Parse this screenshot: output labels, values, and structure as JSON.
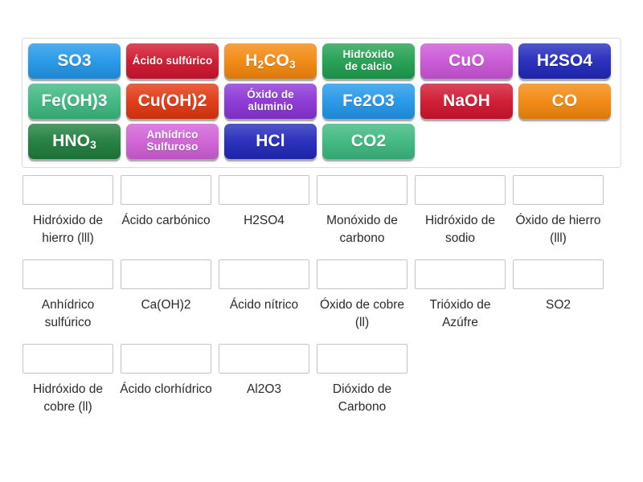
{
  "tray": {
    "name": "draggable-tiles-tray",
    "tiles": [
      {
        "id": "tile-so3",
        "label": "SO3",
        "html": "SO3",
        "color": "#2196e8",
        "size": "fs-big"
      },
      {
        "id": "tile-acido-sulfurico",
        "label": "Ácido sulfúrico",
        "html": "Ácido sulfúrico",
        "color": "#cf152d",
        "size": "fs-small"
      },
      {
        "id": "tile-h2co3",
        "label": "H2CO3",
        "html": "H<sub>2</sub>CO<sub>3</sub>",
        "color": "#f2870d",
        "size": "fs-big"
      },
      {
        "id": "tile-hidroxido-calcio",
        "label": "Hidróxido de calcio",
        "html": "Hidróxido<br>de calcio",
        "color": "#1f9e4f",
        "size": "fs-small"
      },
      {
        "id": "tile-cuo",
        "label": "CuO",
        "html": "CuO",
        "color": "#c955d6",
        "size": "fs-big"
      },
      {
        "id": "tile-h2so4",
        "label": "H2SO4",
        "html": "H2SO4",
        "color": "#2128ba",
        "size": "fs-big"
      },
      {
        "id": "tile-feoh3",
        "label": "Fe(OH)3",
        "html": "Fe(OH)3",
        "color": "#3bb77e",
        "size": "fs-big"
      },
      {
        "id": "tile-cuoh2",
        "label": "Cu(OH)2",
        "html": "Cu(OH)2",
        "color": "#e0360f",
        "size": "fs-big"
      },
      {
        "id": "tile-oxido-aluminio",
        "label": "Óxido de aluminio",
        "html": "Óxido de<br>aluminio",
        "color": "#8a33d6",
        "size": "fs-small"
      },
      {
        "id": "tile-fe2o3",
        "label": "Fe2O3",
        "html": "Fe2O3",
        "color": "#2196e8",
        "size": "fs-big"
      },
      {
        "id": "tile-naoh",
        "label": "NaOH",
        "html": "NaOH",
        "color": "#cf152d",
        "size": "fs-big"
      },
      {
        "id": "tile-co",
        "label": "CO",
        "html": "CO",
        "color": "#f2870d",
        "size": "fs-big"
      },
      {
        "id": "tile-hno3",
        "label": "HNO3",
        "html": "HNO<sub>3</sub>",
        "color": "#1e7c3c",
        "size": "fs-big"
      },
      {
        "id": "tile-anhidrico-sulfuroso",
        "label": "Anhídrico Sulfuroso",
        "html": "Anhídrico<br>Sulfuroso",
        "color": "#cf5fd6",
        "size": "fs-small"
      },
      {
        "id": "tile-hcl",
        "label": "HCl",
        "html": "HCl",
        "color": "#2128ba",
        "size": "fs-big"
      },
      {
        "id": "tile-co2",
        "label": "CO2",
        "html": "CO2",
        "color": "#3bb77e",
        "size": "fs-big"
      }
    ]
  },
  "answers": {
    "name": "answer-dropzones",
    "rows": [
      [
        {
          "id": "zone-hidroxido-hierro-iii",
          "label": "Hidróxido de hierro (lll)",
          "value": ""
        },
        {
          "id": "zone-acido-carbonico",
          "label": "Ácido carbónico",
          "value": ""
        },
        {
          "id": "zone-h2so4",
          "label": "H2SO4",
          "value": ""
        },
        {
          "id": "zone-monoxido-carbono",
          "label": "Monóxido de carbono",
          "value": ""
        },
        {
          "id": "zone-hidroxido-sodio",
          "label": "Hidróxido de sodio",
          "value": ""
        },
        {
          "id": "zone-oxido-hierro-iii",
          "label": "Óxido de hierro (lll)",
          "value": ""
        }
      ],
      [
        {
          "id": "zone-anhidrico-sulfurico",
          "label": "Anhídrico sulfúrico",
          "value": ""
        },
        {
          "id": "zone-caoh2",
          "label": "Ca(OH)2",
          "value": ""
        },
        {
          "id": "zone-acido-nitrico",
          "label": "Ácido nítrico",
          "value": ""
        },
        {
          "id": "zone-oxido-cobre-ii",
          "label": "Óxido de cobre (ll)",
          "value": ""
        },
        {
          "id": "zone-trioxido-azufre",
          "label": "Trióxido de Azúfre",
          "value": ""
        },
        {
          "id": "zone-so2",
          "label": "SO2",
          "value": ""
        }
      ],
      [
        {
          "id": "zone-hidroxido-cobre-ii",
          "label": "Hidróxido de cobre (ll)",
          "value": ""
        },
        {
          "id": "zone-acido-clorhidrico",
          "label": "Ácido clorhídrico",
          "value": ""
        },
        {
          "id": "zone-al2o3",
          "label": "Al2O3",
          "value": ""
        },
        {
          "id": "zone-dioxido-carbono",
          "label": "Dióxido de Carbono",
          "value": ""
        }
      ]
    ]
  }
}
